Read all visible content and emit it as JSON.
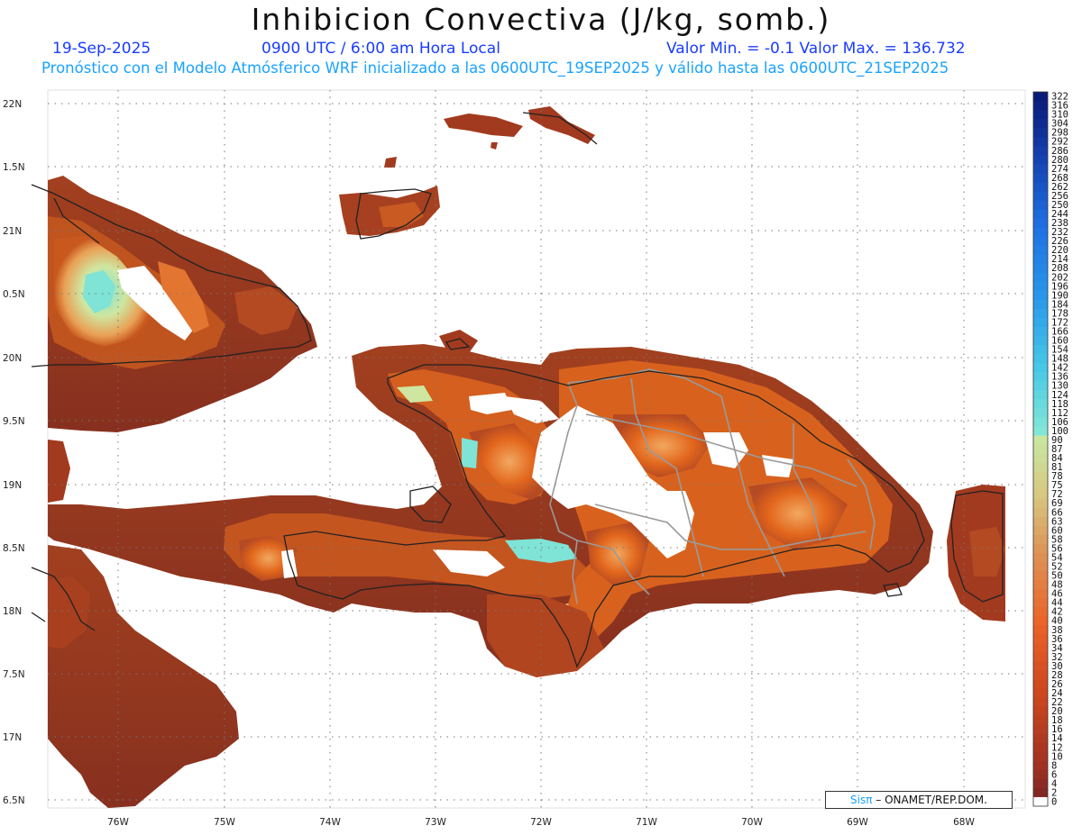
{
  "header": {
    "title": "Inhibicion Convectiva (J/kg, somb.)",
    "date": "19-Sep-2025",
    "time": "0900 UTC / 6:00 am Hora Local",
    "minmax": "Valor Min. = -0.1  Valor Max. = 136.732",
    "model_line": "Pronóstico con el Modelo Atmósferico WRF inicializado a las 0600UTC_19SEP2025 y válido hasta las  0600UTC_21SEP2025"
  },
  "axes": {
    "lat_labels": [
      "22N",
      "1.5N",
      "21N",
      "0.5N",
      "20N",
      "9.5N",
      "19N",
      "8.5N",
      "18N",
      "7.5N",
      "17N",
      "6.5N"
    ],
    "lon_labels": [
      "76W",
      "75W",
      "74W",
      "73W",
      "72W",
      "71W",
      "70W",
      "69W",
      "68W"
    ]
  },
  "colorbar": {
    "labels": [
      "322",
      "316",
      "310",
      "304",
      "298",
      "292",
      "286",
      "280",
      "274",
      "268",
      "262",
      "256",
      "250",
      "244",
      "238",
      "232",
      "226",
      "220",
      "214",
      "208",
      "202",
      "196",
      "190",
      "184",
      "178",
      "172",
      "166",
      "160",
      "154",
      "148",
      "142",
      "136",
      "130",
      "124",
      "118",
      "112",
      "106",
      "100",
      "90",
      "87",
      "84",
      "81",
      "78",
      "75",
      "72",
      "69",
      "66",
      "63",
      "60",
      "58",
      "56",
      "54",
      "52",
      "50",
      "48",
      "46",
      "44",
      "42",
      "40",
      "38",
      "36",
      "34",
      "32",
      "30",
      "28",
      "26",
      "24",
      "22",
      "20",
      "18",
      "16",
      "14",
      "12",
      "10",
      "8",
      "6",
      "4",
      "2",
      "0"
    ]
  },
  "credit": {
    "sis": "Sisπ",
    "rest": " – ONAMET/REP.DOM."
  },
  "colors": {
    "deep": "#8a3020",
    "mid": "#b54a22",
    "orange": "#e0641a",
    "bright": "#f08030",
    "light": "#e9b070",
    "green": "#cfe6a0",
    "cyan": "#7fe3d6",
    "coast": "#222222",
    "border_gray": "#9a9a9a"
  }
}
